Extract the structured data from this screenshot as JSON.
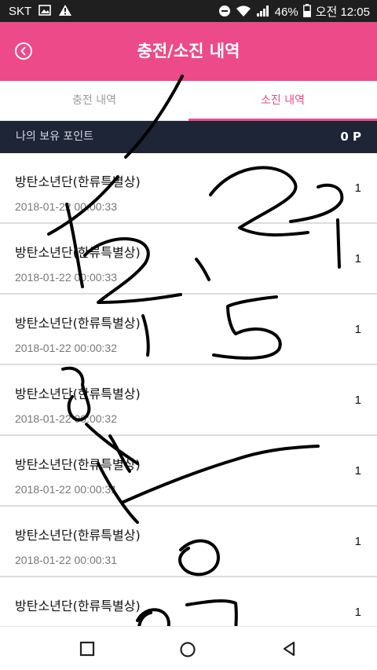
{
  "status_bar": {
    "carrier": "SKT",
    "battery": "46%",
    "time": "오전 12:05"
  },
  "header": {
    "title": "충전/소진 내역"
  },
  "tabs": [
    {
      "label": "충전 내역",
      "active": false
    },
    {
      "label": "소진 내역",
      "active": true
    }
  ],
  "points": {
    "label": "나의 보유 포인트",
    "value": "0 P"
  },
  "rows": [
    {
      "title": "방탄소년단(한류특별상)",
      "date": "2018-01-22 00:00:33",
      "value": "1"
    },
    {
      "title": "방탄소년단(한류특별상)",
      "date": "2018-01-22 00:00:33",
      "value": "1"
    },
    {
      "title": "방탄소년단(한류특별상)",
      "date": "2018-01-22 00:00:32",
      "value": "1"
    },
    {
      "title": "방탄소년단(한류특별상)",
      "date": "2018-01-22 00:00:32",
      "value": "1"
    },
    {
      "title": "방탄소년단(한류특별상)",
      "date": "2018-01-22 00:00:31",
      "value": "1"
    },
    {
      "title": "방탄소년단(한류특별상)",
      "date": "2018-01-22 00:00:31",
      "value": "1"
    },
    {
      "title": "방탄소년단(한류특별상)",
      "date": "",
      "value": "1"
    }
  ],
  "handwriting": "12.25 입방 07",
  "colors": {
    "accent": "#ec4a88",
    "points_bar": "#1d2537",
    "status_bar": "#1f1f1f"
  }
}
